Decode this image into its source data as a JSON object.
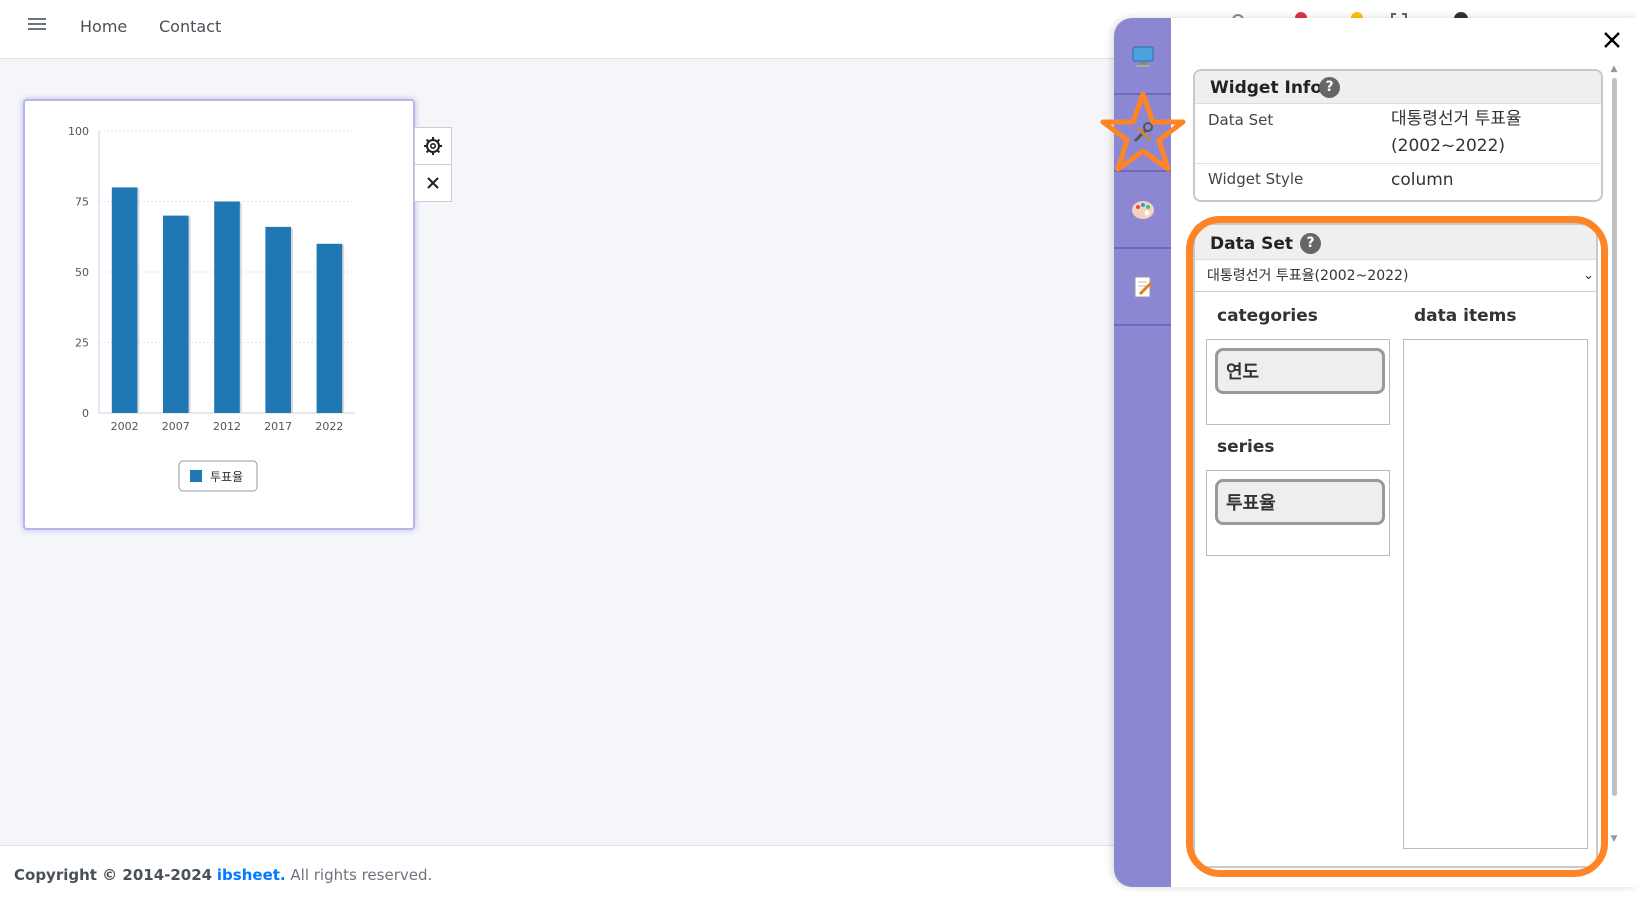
{
  "nav": {
    "menu_icon": "hamburger-icon",
    "links": [
      "Home",
      "Contact"
    ]
  },
  "footer": {
    "copyright": "Copyright © 2014-2024",
    "brand": "ibsheet.",
    "suffix": "All rights reserved."
  },
  "widget": {
    "settings_icon": "gear-icon",
    "close_icon": "close-icon"
  },
  "chart_data": {
    "type": "bar",
    "categories": [
      "2002",
      "2007",
      "2012",
      "2017",
      "2022"
    ],
    "series": [
      {
        "name": "투표율",
        "values": [
          80,
          70,
          75,
          66,
          60
        ]
      }
    ],
    "yticks": [
      "100",
      "75",
      "50",
      "25",
      "0"
    ],
    "ylim": [
      0,
      100
    ],
    "grid": true,
    "legend": "bottom-center",
    "colors": {
      "bar": "#1f77b4"
    }
  },
  "panel": {
    "close_icon": "close-icon",
    "tabs": [
      "monitor-icon",
      "tools-icon",
      "palette-icon",
      "edit-note-icon"
    ],
    "widget_info": {
      "title": "Widget Info",
      "help": "?",
      "rows": [
        {
          "key": "Data Set",
          "value_line1": "대통령선거 투표율",
          "value_line2": "(2002~2022)"
        },
        {
          "key": "Widget Style",
          "value": "column"
        }
      ]
    },
    "data_set": {
      "title": "Data Set",
      "help": "?",
      "selected": "대통령선거 투표율(2002~2022)",
      "categories_label": "categories",
      "data_items_label": "data items",
      "series_label": "series",
      "category_chip": "연도",
      "series_chip": "투표율"
    },
    "highlight_color": "#ff8425",
    "tab_bar_color": "#8b87d3"
  }
}
